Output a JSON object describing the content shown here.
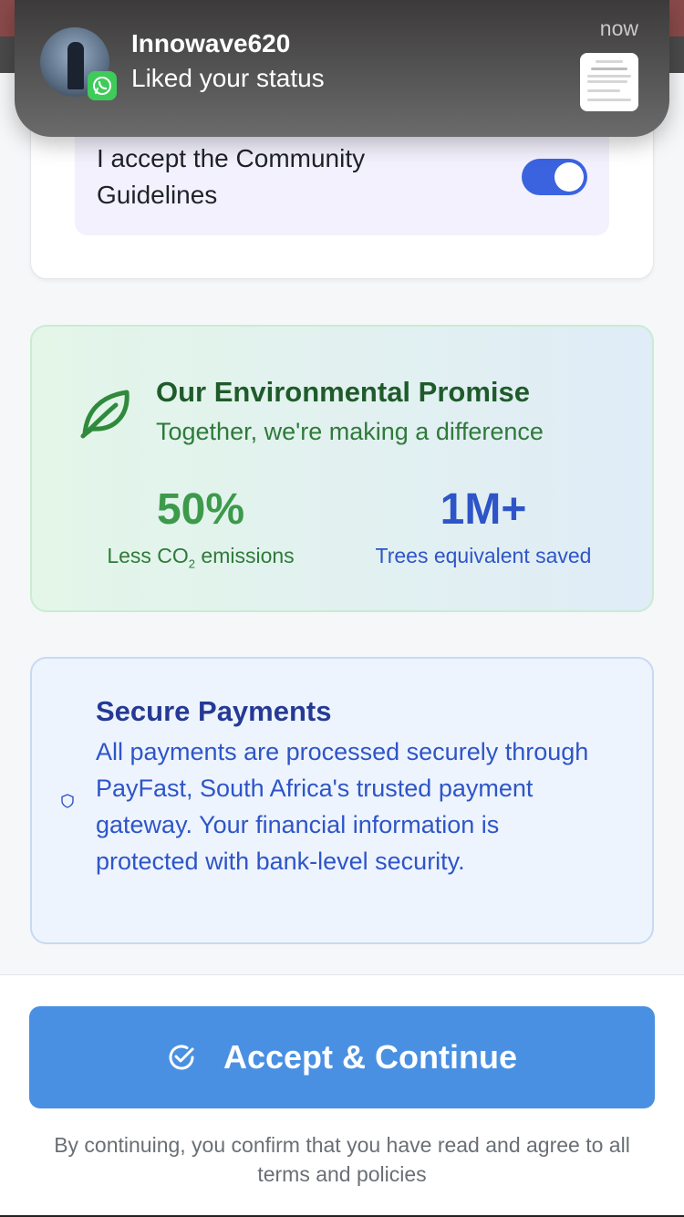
{
  "notification": {
    "sender": "Innowave620",
    "message": "Liked your status",
    "time": "now",
    "app_icon": "whatsapp-icon"
  },
  "guidelines": {
    "label": "I accept the Community Guidelines",
    "toggle_on": true
  },
  "environment": {
    "title": "Our Environmental Promise",
    "subtitle": "Together, we're making a difference",
    "icon": "leaf-icon",
    "stats": [
      {
        "value": "50%",
        "label_prefix": "Less CO",
        "label_sub": "2",
        "label_suffix": " emissions"
      },
      {
        "value": "1M+",
        "label": "Trees equivalent saved"
      }
    ]
  },
  "payments": {
    "title": "Secure Payments",
    "body": "All payments are processed securely through PayFast, South Africa's trusted payment gateway. Your financial information is protected with bank-level security.",
    "icon": "shield-icon"
  },
  "footer": {
    "button_label": "Accept & Continue",
    "button_icon": "check-circle-icon",
    "disclaimer": "By continuing, you confirm that you have read and agree to all terms and policies"
  },
  "colors": {
    "accent_blue": "#4a90e2",
    "toggle_blue": "#3b63e0",
    "green_dark": "#1f5b2a",
    "blue_dark": "#253a94"
  }
}
